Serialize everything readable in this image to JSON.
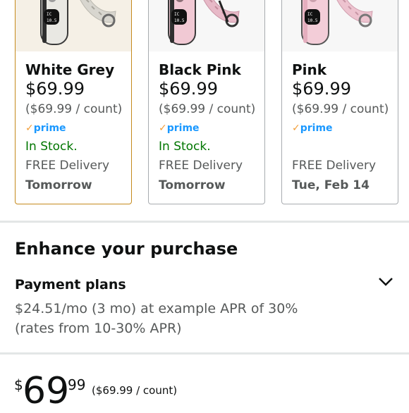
{
  "variants": [
    {
      "name": "White Grey",
      "price": "$69.99",
      "unit_price": "($69.99 / count)",
      "prime": "prime",
      "prime_check": "✓",
      "stock": "In Stock.",
      "delivery": "FREE Delivery",
      "date": "Tomorrow",
      "selected": true
    },
    {
      "name": "Black Pink",
      "price": "$69.99",
      "unit_price": "($69.99 / count)",
      "prime": "prime",
      "prime_check": "✓",
      "stock": "In Stock.",
      "delivery": "FREE Delivery",
      "date": "Tomorrow",
      "selected": false
    },
    {
      "name": "Pink",
      "price": "$69.99",
      "unit_price": "($69.99 / count)",
      "prime": "prime",
      "prime_check": "✓",
      "stock": "",
      "delivery": "FREE Delivery",
      "date": "Tue, Feb 14",
      "selected": false
    }
  ],
  "enhance": {
    "title": "Enhance your purchase",
    "payment_plans_label": "Payment plans",
    "expand_icon": "chevron-down-icon",
    "plan_line1": "$24.51/mo (3 mo) at example APR of 30%",
    "plan_line2": "(rates from 10-30% APR)"
  },
  "buybox": {
    "currency": "$",
    "price_whole": "69",
    "price_fraction": "99",
    "unit_price": "($69.99 / count)"
  },
  "colors": {
    "prime_blue": "#1a98ff",
    "in_stock_green": "#007600",
    "selected_border": "#c58a1c"
  }
}
